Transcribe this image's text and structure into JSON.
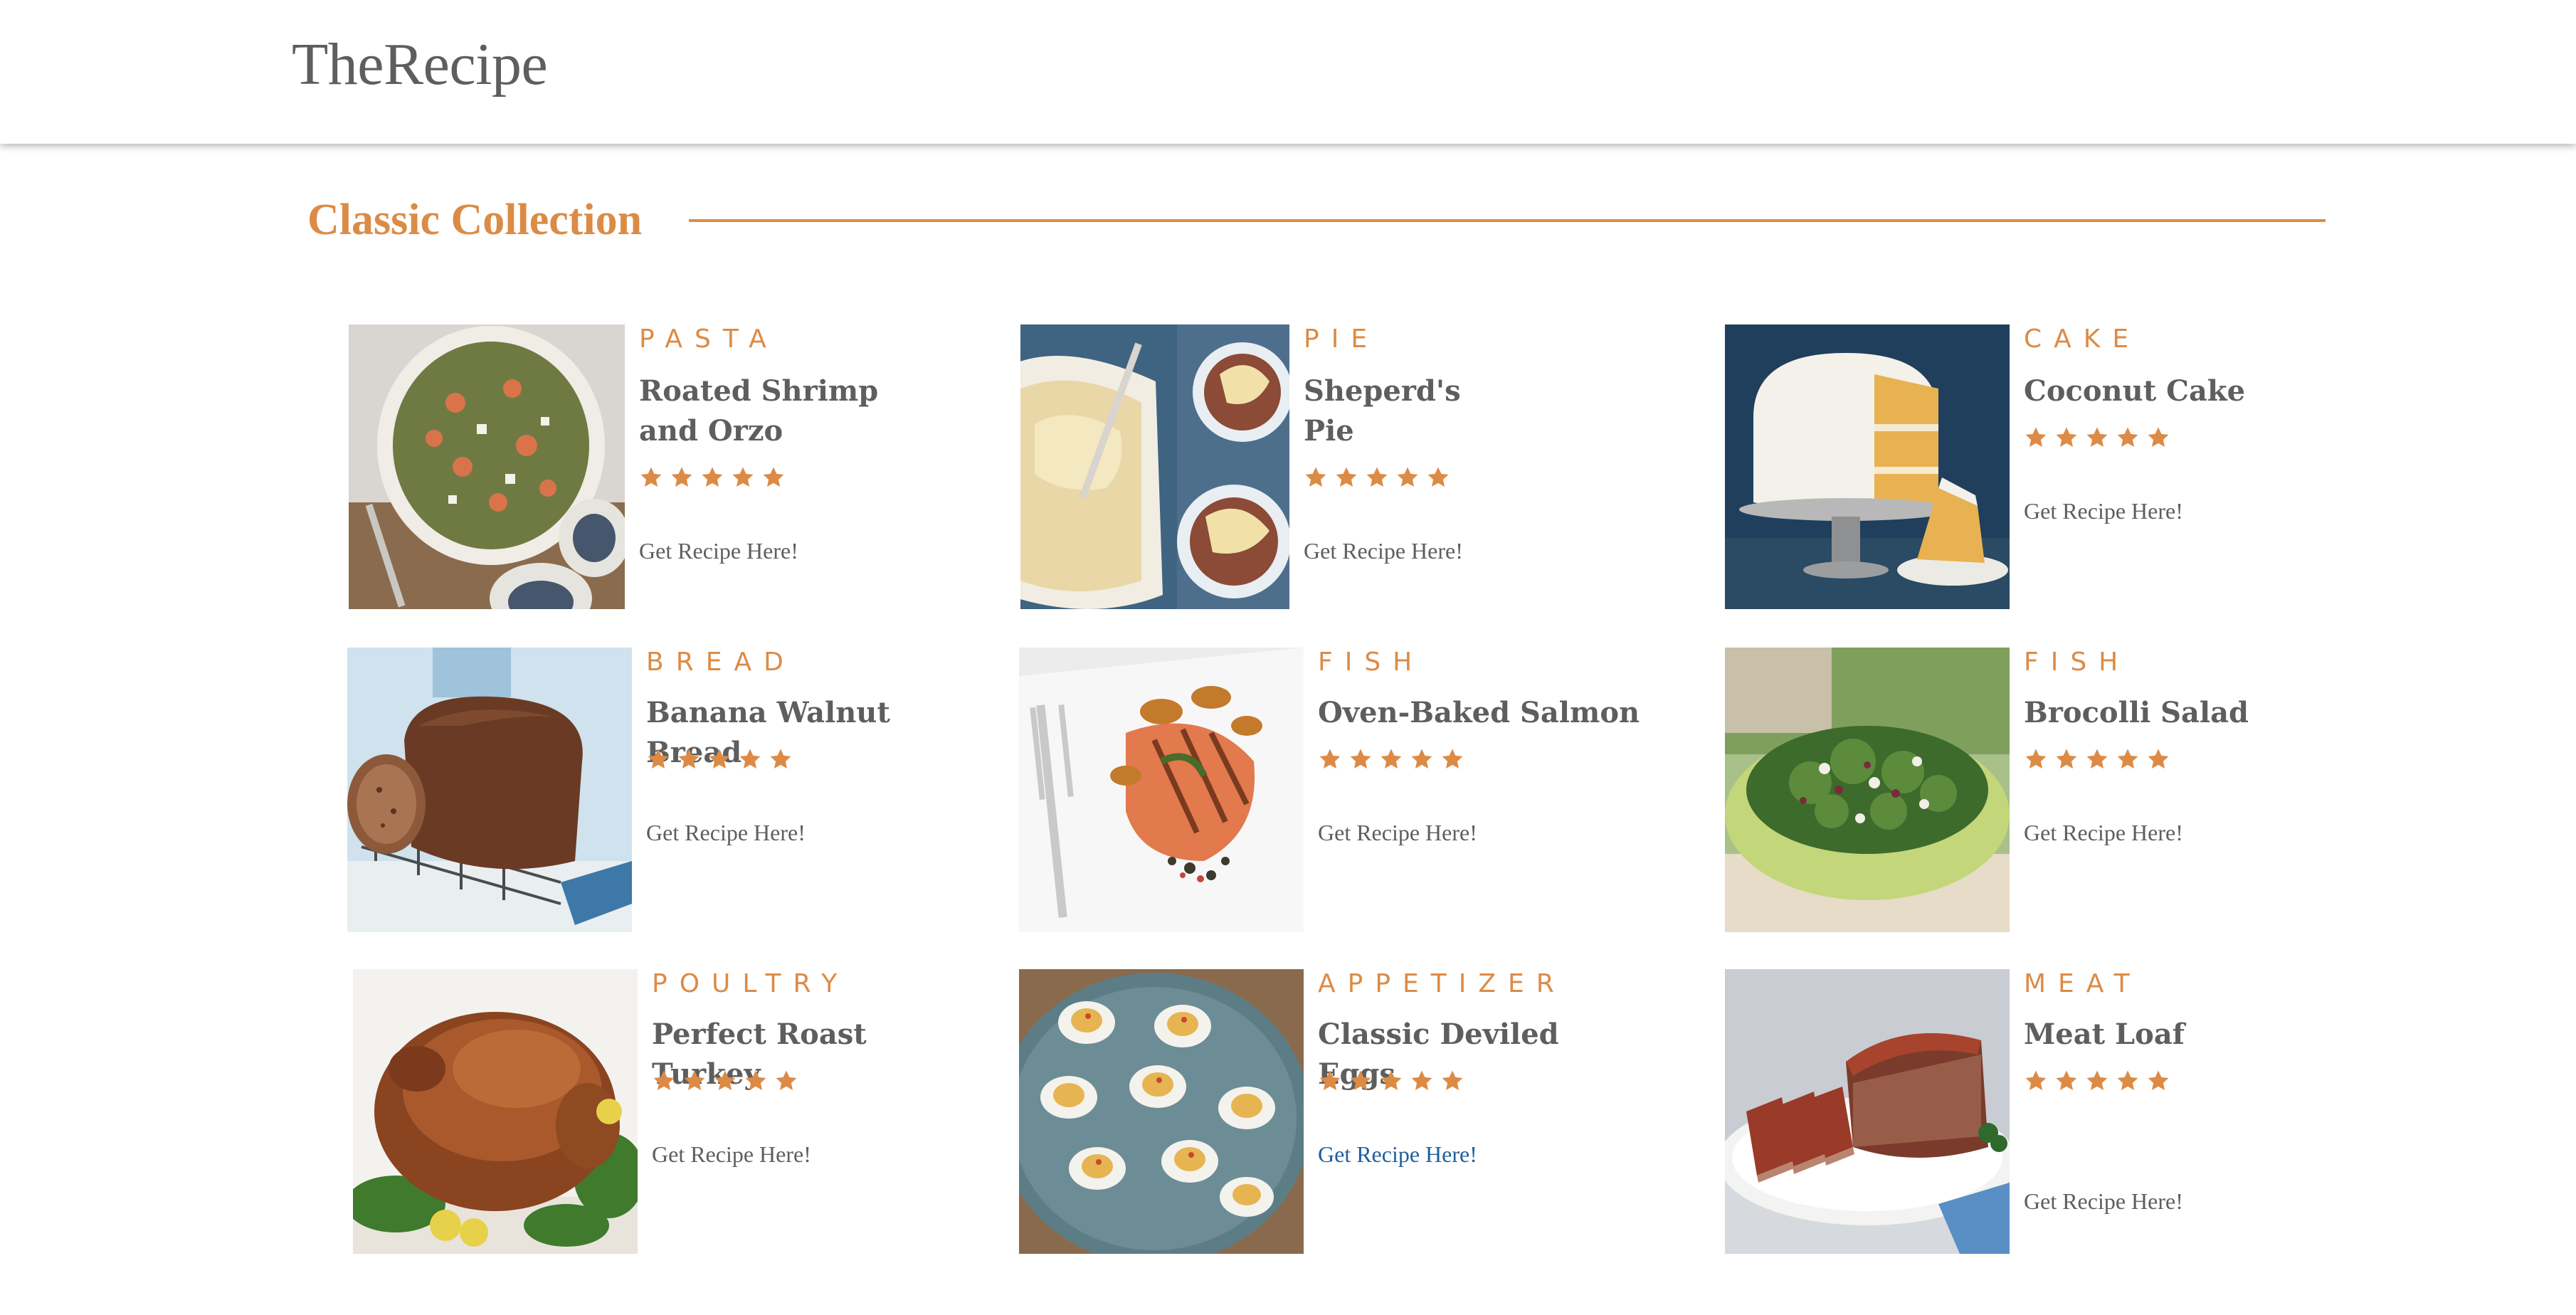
{
  "header": {
    "brand": "TheRecipe"
  },
  "section": {
    "title": "Classic Collection"
  },
  "colors": {
    "accent": "#dc8b46",
    "text": "#5e5e5e",
    "link_active": "#1f5f9e"
  },
  "recipes": [
    {
      "category": "PASTA",
      "title": "Roated Shrimp and Orzo",
      "rating": 5,
      "link": "Get Recipe Here!",
      "image": "shrimp-orzo-photo"
    },
    {
      "category": "PIE",
      "title": "Sheperd's Pie",
      "rating": 5,
      "link": "Get Recipe Here!",
      "image": "shepherds-pie-photo"
    },
    {
      "category": "CAKE",
      "title": "Coconut Cake",
      "rating": 5,
      "link": "Get Recipe Here!",
      "image": "coconut-cake-photo"
    },
    {
      "category": "BREAD",
      "title": "Banana Walnut Bread",
      "rating": 5,
      "link": "Get Recipe Here!",
      "image": "banana-bread-photo"
    },
    {
      "category": "FISH",
      "title": "Oven-Baked Salmon",
      "rating": 5,
      "link": "Get Recipe Here!",
      "image": "salmon-photo"
    },
    {
      "category": "FISH",
      "title": "Brocolli Salad",
      "rating": 5,
      "link": "Get Recipe Here!",
      "image": "broccoli-salad-photo"
    },
    {
      "category": "POULTRY",
      "title": "Perfect Roast Turkey",
      "rating": 5,
      "link": "Get Recipe Here!",
      "image": "roast-turkey-photo"
    },
    {
      "category": "APPETIZER",
      "title": "Classic Deviled Eggs",
      "rating": 5,
      "link": "Get Recipe Here!",
      "image": "deviled-eggs-photo"
    },
    {
      "category": "MEAT",
      "title": "Meat Loaf",
      "rating": 5,
      "link": "Get Recipe Here!",
      "image": "meat-loaf-photo"
    }
  ]
}
